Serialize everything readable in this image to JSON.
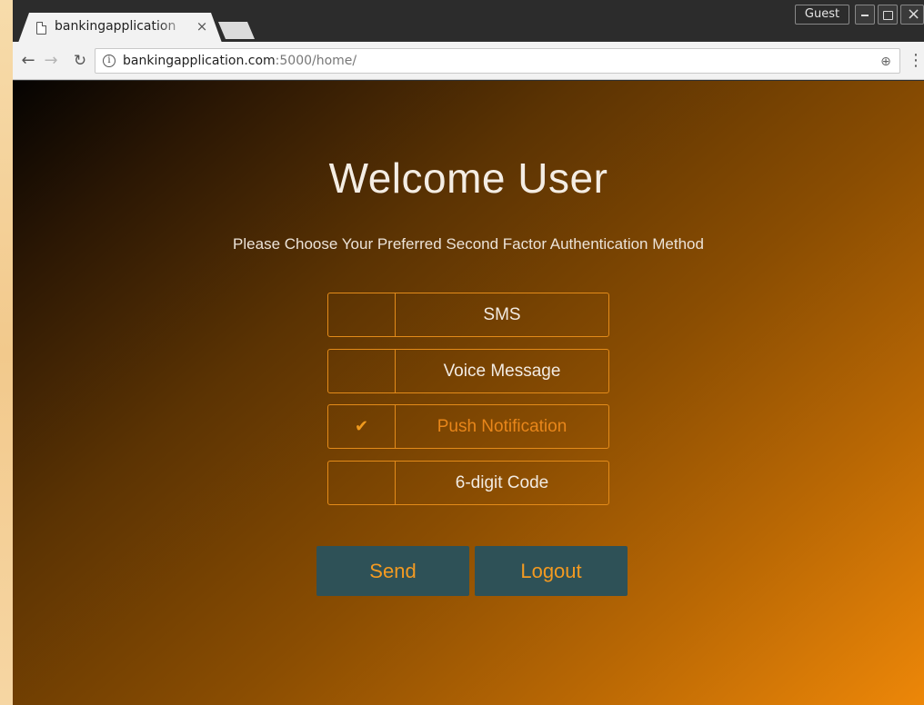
{
  "browser": {
    "tab_title": "bankingapplication",
    "tab_close": "×",
    "profile_badge": "Guest",
    "url_host": "bankingapplication.com",
    "url_rest": ":5000/home/",
    "icons": {
      "page": "page-icon",
      "back": "back-arrow-icon",
      "forward": "forward-arrow-icon",
      "reload": "reload-icon",
      "info": "info-icon",
      "zoom": "zoom-icon",
      "menu": "menu-dots-icon"
    }
  },
  "page": {
    "title": "Welcome User",
    "subtitle": "Please Choose Your Preferred Second Factor Authentication Method",
    "options": [
      {
        "label": "SMS",
        "selected": false
      },
      {
        "label": "Voice Message",
        "selected": false
      },
      {
        "label": "Push Notification",
        "selected": true
      },
      {
        "label": "6-digit Code",
        "selected": false
      }
    ],
    "check_mark": "✔",
    "send_label": "Send",
    "logout_label": "Logout",
    "colors": {
      "accent": "#e38b1a",
      "button_bg": "#2e5157",
      "button_text": "#f39a21"
    }
  }
}
